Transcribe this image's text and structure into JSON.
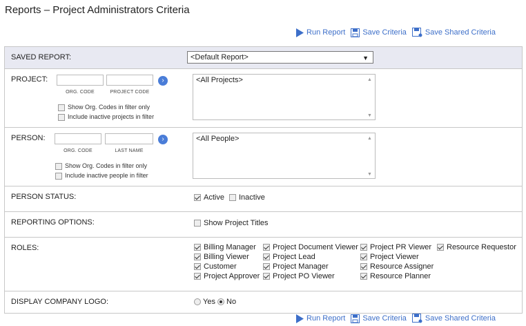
{
  "page_title": "Reports – Project Administrators Criteria",
  "toolbar": {
    "run_report": "Run Report",
    "save_criteria": "Save Criteria",
    "save_shared_criteria": "Save Shared Criteria"
  },
  "saved_report": {
    "label": "SAVED REPORT:",
    "selected": "<Default Report>"
  },
  "project": {
    "label": "PROJECT:",
    "org_code_label": "ORG. CODE",
    "project_code_label": "PROJECT CODE",
    "show_org_codes": "Show Org. Codes in filter only",
    "include_inactive": "Include inactive projects in filter",
    "list_value": "<All Projects>"
  },
  "person": {
    "label": "PERSON:",
    "org_code_label": "ORG. CODE",
    "last_name_label": "LAST NAME",
    "show_org_codes": "Show Org. Codes in filter only",
    "include_inactive": "Include inactive people in filter",
    "list_value": "<All People>"
  },
  "person_status": {
    "label": "PERSON STATUS:",
    "active": "Active",
    "inactive": "Inactive"
  },
  "reporting_options": {
    "label": "REPORTING OPTIONS:",
    "show_project_titles": "Show Project Titles"
  },
  "roles": {
    "label": "ROLES:",
    "items": [
      "Billing Manager",
      "Billing Viewer",
      "Customer",
      "Project Approver",
      "Project Document Viewer",
      "Project Lead",
      "Project Manager",
      "Project PO Viewer",
      "Project PR Viewer",
      "Project Viewer",
      "Resource Assigner",
      "Resource Planner",
      "Resource Requestor"
    ]
  },
  "display_logo": {
    "label": "DISPLAY COMPANY LOGO:",
    "yes": "Yes",
    "no": "No"
  },
  "colors": {
    "accent": "#3d6fc9",
    "saved_row_bg": "#e8e9f2",
    "border": "#c7c7c7"
  }
}
